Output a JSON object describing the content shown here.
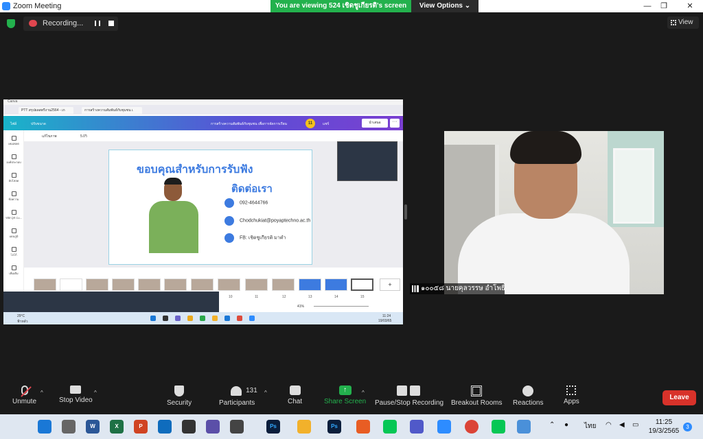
{
  "window": {
    "title": "Zoom Meeting",
    "min": "—",
    "max": "❐",
    "close": "✕"
  },
  "banner": {
    "viewing": "You are viewing 524 เชิดชูเกียรติ's screen",
    "view_options": "View Options ⌄"
  },
  "recording": {
    "label": "Recording..."
  },
  "view_button": "View",
  "shared_screen": {
    "app_title": "Canva",
    "tabs": [
      "PTT สรุปผลสตรีงาน2564 - เก",
      "การสร้างความสัมพันธ์กับชุมชน เ"
    ],
    "toolbar": {
      "file": "ไฟล์",
      "resize": "ปรับขนาด",
      "doc_title": "การสร้างความสัมพันธ์กับชุมชน เพื่อการจัดการเรียน",
      "avatar": "11",
      "share": "แชร์",
      "present": "นำเสนอ"
    },
    "sidebar": [
      "เทมเพลต",
      "องค์ประกอบ",
      "อัปโหลด",
      "ข้อความ",
      "รหัส QR Co...",
      "แผนภูมิ",
      "โลโก้",
      "เพิ่มเติม"
    ],
    "canvas_bar": {
      "edit_image": "แก้ไขภาพ",
      "timer": "5.0วิ"
    },
    "slide": {
      "title": "ขอบคุณสำหรับการรับฟัง",
      "subtitle": "ติดต่อเรา",
      "phone": "092-4644766",
      "email": "Chodchukiat@poyaptechno.ac.th",
      "fb": "FB: เชิดชูเกียรติ มาคำ"
    },
    "thumb_numbers": [
      "10",
      "11",
      "12",
      "13",
      "14",
      "15"
    ],
    "zoom_level": "41%",
    "mini_taskbar": {
      "weather": "29°C",
      "weather_sub": "ฟ้าหลัว",
      "time": "11:24",
      "date": "19/03/65"
    }
  },
  "participant": {
    "name": "๑๐๐๕๘ นายคุลวรรษ อำโพธิ์"
  },
  "controls": {
    "unmute": "Unmute",
    "stop_video": "Stop Video",
    "security": "Security",
    "participants": "Participants",
    "participants_count": "131",
    "chat": "Chat",
    "share_screen": "Share Screen",
    "pause_stop_recording": "Pause/Stop Recording",
    "breakout_rooms": "Breakout Rooms",
    "reactions": "Reactions",
    "apps": "Apps",
    "leave": "Leave"
  },
  "taskbar": {
    "apps": [
      "W",
      "X",
      "P",
      "Ps",
      "Ps"
    ],
    "language": "ไทย",
    "time": "11:25",
    "date": "19/3/2565",
    "notifications": "3"
  },
  "colors": {
    "zoom_green": "#23b14d",
    "leave_red": "#d8322a",
    "canva_blue": "#3d7be0"
  }
}
